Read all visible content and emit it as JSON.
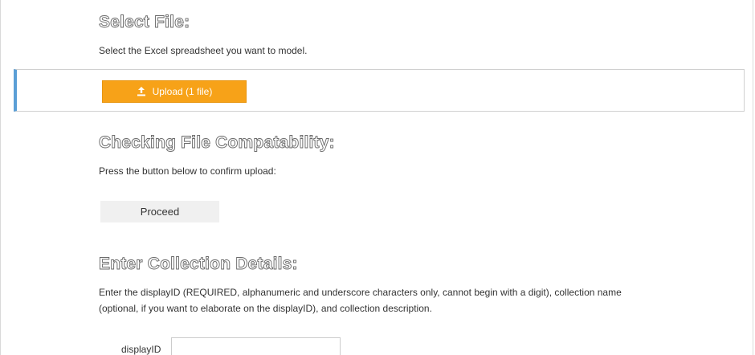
{
  "select_file": {
    "heading": "Select File:",
    "description": "Select the Excel spreadsheet you want to model.",
    "upload_button_label": "Upload (1 file)",
    "upload_icon": "upload-icon"
  },
  "compatibility": {
    "heading": "Checking File Compatability:",
    "description": "Press the button below to confirm upload:",
    "proceed_button_label": "Proceed"
  },
  "collection": {
    "heading": "Enter Collection Details:",
    "description_line1": "Enter the displayID (REQUIRED, alphanumeric and underscore characters only, cannot begin with a digit), collection name",
    "description_line2": "(optional, if you want to elaborate on the displayID), and collection description.",
    "display_id_label": "displayID",
    "display_id_value": ""
  },
  "colors": {
    "upload_button": "#f7a218",
    "panel_accent": "#5b9fd6",
    "proceed_button": "#f0f0f0"
  }
}
